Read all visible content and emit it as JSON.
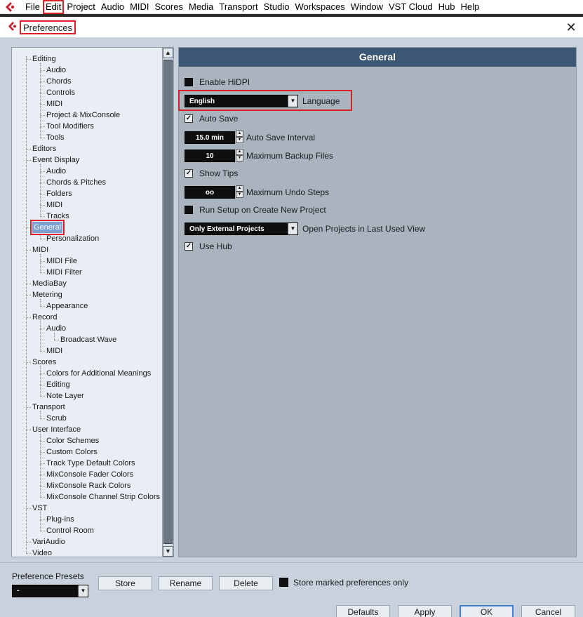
{
  "menubar": {
    "items": [
      "File",
      "Edit",
      "Project",
      "Audio",
      "MIDI",
      "Scores",
      "Media",
      "Transport",
      "Studio",
      "Workspaces",
      "Window",
      "VST Cloud",
      "Hub",
      "Help"
    ],
    "highlighted": "Edit",
    "logo_icon": "cubase-logo-icon"
  },
  "window": {
    "title": "Preferences",
    "close_glyph": "✕"
  },
  "tree": {
    "items": [
      {
        "label": "Editing",
        "level": 0
      },
      {
        "label": "Audio",
        "level": 1
      },
      {
        "label": "Chords",
        "level": 1
      },
      {
        "label": "Controls",
        "level": 1
      },
      {
        "label": "MIDI",
        "level": 1
      },
      {
        "label": "Project & MixConsole",
        "level": 1
      },
      {
        "label": "Tool Modifiers",
        "level": 1
      },
      {
        "label": "Tools",
        "level": 1
      },
      {
        "label": "Editors",
        "level": 0
      },
      {
        "label": "Event Display",
        "level": 0
      },
      {
        "label": "Audio",
        "level": 1
      },
      {
        "label": "Chords & Pitches",
        "level": 1
      },
      {
        "label": "Folders",
        "level": 1
      },
      {
        "label": "MIDI",
        "level": 1
      },
      {
        "label": "Tracks",
        "level": 1
      },
      {
        "label": "General",
        "level": 0,
        "selected": true
      },
      {
        "label": "Personalization",
        "level": 1
      },
      {
        "label": "MIDI",
        "level": 0
      },
      {
        "label": "MIDI File",
        "level": 1
      },
      {
        "label": "MIDI Filter",
        "level": 1
      },
      {
        "label": "MediaBay",
        "level": 0
      },
      {
        "label": "Metering",
        "level": 0
      },
      {
        "label": "Appearance",
        "level": 1
      },
      {
        "label": "Record",
        "level": 0
      },
      {
        "label": "Audio",
        "level": 1
      },
      {
        "label": "Broadcast Wave",
        "level": 2
      },
      {
        "label": "MIDI",
        "level": 1
      },
      {
        "label": "Scores",
        "level": 0
      },
      {
        "label": "Colors for Additional Meanings",
        "level": 1
      },
      {
        "label": "Editing",
        "level": 1
      },
      {
        "label": "Note Layer",
        "level": 1
      },
      {
        "label": "Transport",
        "level": 0
      },
      {
        "label": "Scrub",
        "level": 1
      },
      {
        "label": "User Interface",
        "level": 0
      },
      {
        "label": "Color Schemes",
        "level": 1
      },
      {
        "label": "Custom Colors",
        "level": 1
      },
      {
        "label": "Track Type Default Colors",
        "level": 1
      },
      {
        "label": "MixConsole Fader Colors",
        "level": 1
      },
      {
        "label": "MixConsole Rack Colors",
        "level": 1
      },
      {
        "label": "MixConsole Channel Strip Colors",
        "level": 1
      },
      {
        "label": "VST",
        "level": 0
      },
      {
        "label": "Plug-ins",
        "level": 1
      },
      {
        "label": "Control Room",
        "level": 1
      },
      {
        "label": "VariAudio",
        "level": 0
      },
      {
        "label": "Video",
        "level": 0
      }
    ]
  },
  "general": {
    "header": "General",
    "enable_hidpi": {
      "label": "Enable HiDPI",
      "checked": false
    },
    "language": {
      "value": "English",
      "label": "Language"
    },
    "auto_save": {
      "label": "Auto Save",
      "checked": true
    },
    "auto_save_interval": {
      "value": "15.0 min",
      "label": "Auto Save Interval"
    },
    "max_backup": {
      "value": "10",
      "label": "Maximum Backup Files"
    },
    "show_tips": {
      "label": "Show Tips",
      "checked": true
    },
    "max_undo": {
      "value": "oo",
      "label": "Maximum Undo Steps"
    },
    "run_setup": {
      "label": "Run Setup on Create New Project",
      "checked": false
    },
    "open_projects": {
      "value": "Only External Projects",
      "label": "Open Projects in Last Used View"
    },
    "use_hub": {
      "label": "Use Hub",
      "checked": true
    }
  },
  "presets": {
    "label": "Preference Presets",
    "value": "-",
    "store": "Store",
    "rename": "Rename",
    "delete": "Delete",
    "store_marked_only": "Store marked preferences only"
  },
  "dialog_buttons": {
    "defaults": "Defaults",
    "apply": "Apply",
    "ok": "OK",
    "cancel": "Cancel"
  },
  "colors": {
    "header_bg": "#3b5773",
    "panel_bg": "#a9b4bf",
    "highlight_red": "#d9202a",
    "selection_blue": "#7b9fcf"
  }
}
